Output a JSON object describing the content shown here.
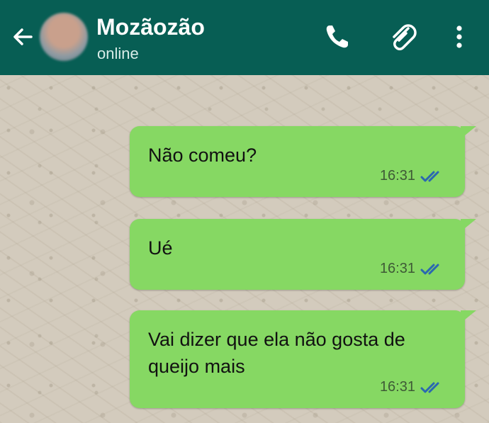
{
  "header": {
    "contact_name": "Mozãozão",
    "status": "online",
    "colors": {
      "bar": "#075e54",
      "title": "#ffffff"
    },
    "icons": [
      "back-arrow-icon",
      "avatar",
      "phone-icon",
      "paperclip-icon",
      "more-vert-icon"
    ]
  },
  "messages": [
    {
      "text": "Não comeu?",
      "time": "16:31",
      "status": "read"
    },
    {
      "text": "Ué",
      "time": "16:31",
      "status": "read"
    },
    {
      "text": "Vai dizer que ela não gosta de queijo mais",
      "time": "16:31",
      "status": "read"
    }
  ],
  "colors": {
    "bubble_outgoing": "#86d863",
    "read_ticks": "#2b68b0"
  }
}
